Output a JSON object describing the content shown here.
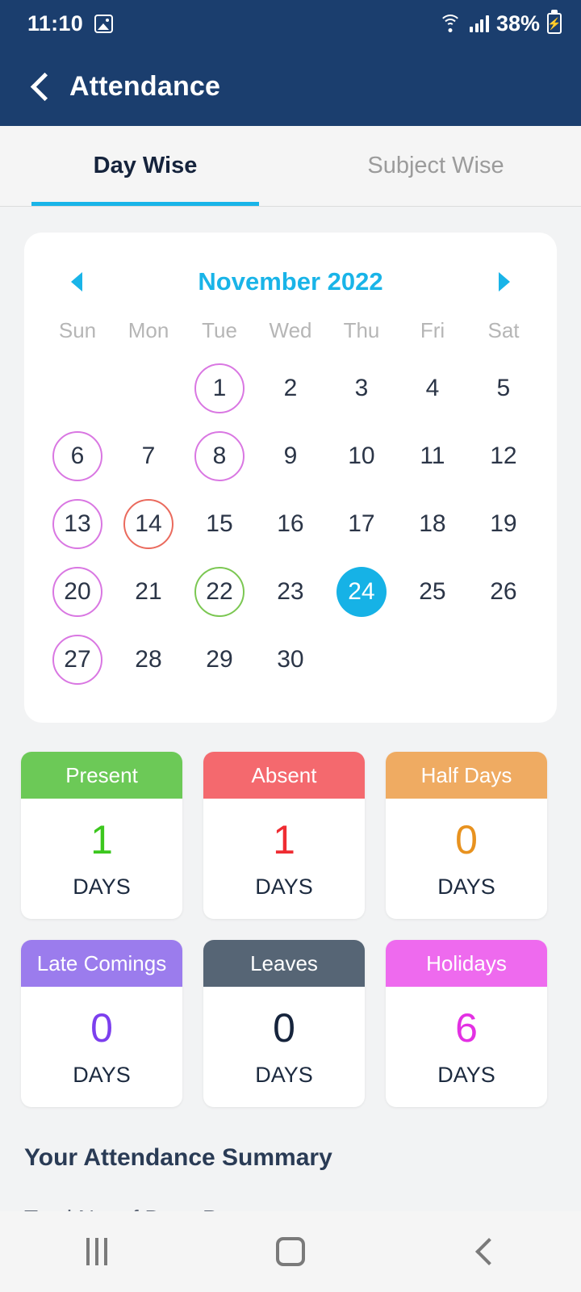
{
  "status_bar": {
    "time": "11:10",
    "image_icon": "image-icon",
    "wifi_icon": "wifi-icon",
    "signal_icon": "signal-bars-icon",
    "battery_percent": "38%",
    "battery_icon": "battery-charging-icon"
  },
  "header": {
    "back_icon": "back-chevron-icon",
    "title": "Attendance",
    "bg_color": "#1b3e6e"
  },
  "tabs": [
    {
      "label": "Day Wise",
      "active": true
    },
    {
      "label": "Subject Wise",
      "active": false
    }
  ],
  "accent_color": "#19b4e8",
  "calendar": {
    "prev_icon": "chevron-left-icon",
    "next_icon": "chevron-right-icon",
    "month_label": "November 2022",
    "weekdays": [
      "Sun",
      "Mon",
      "Tue",
      "Wed",
      "Thu",
      "Fri",
      "Sat"
    ],
    "leading_blanks": 2,
    "days": [
      {
        "day": "1",
        "state": "holiday"
      },
      {
        "day": "2",
        "state": "none"
      },
      {
        "day": "3",
        "state": "none"
      },
      {
        "day": "4",
        "state": "none"
      },
      {
        "day": "5",
        "state": "none"
      },
      {
        "day": "6",
        "state": "holiday"
      },
      {
        "day": "7",
        "state": "none"
      },
      {
        "day": "8",
        "state": "holiday"
      },
      {
        "day": "9",
        "state": "none"
      },
      {
        "day": "10",
        "state": "none"
      },
      {
        "day": "11",
        "state": "none"
      },
      {
        "day": "12",
        "state": "none"
      },
      {
        "day": "13",
        "state": "holiday"
      },
      {
        "day": "14",
        "state": "absent"
      },
      {
        "day": "15",
        "state": "none"
      },
      {
        "day": "16",
        "state": "none"
      },
      {
        "day": "17",
        "state": "none"
      },
      {
        "day": "18",
        "state": "none"
      },
      {
        "day": "19",
        "state": "none"
      },
      {
        "day": "20",
        "state": "holiday"
      },
      {
        "day": "21",
        "state": "none"
      },
      {
        "day": "22",
        "state": "present"
      },
      {
        "day": "23",
        "state": "none"
      },
      {
        "day": "24",
        "state": "today"
      },
      {
        "day": "25",
        "state": "none"
      },
      {
        "day": "26",
        "state": "none"
      },
      {
        "day": "27",
        "state": "holiday"
      },
      {
        "day": "28",
        "state": "none"
      },
      {
        "day": "29",
        "state": "none"
      },
      {
        "day": "30",
        "state": "none"
      }
    ],
    "legend_colors": {
      "holiday": "#d977e2",
      "absent": "#ea6a5d",
      "present": "#7bc752",
      "today": "#16b2e6"
    }
  },
  "stats": [
    {
      "label": "Present",
      "value": "1",
      "unit": "DAYS",
      "header_color": "#6cc957",
      "value_color": "#3cc71e"
    },
    {
      "label": "Absent",
      "value": "1",
      "unit": "DAYS",
      "header_color": "#f4696e",
      "value_color": "#ef2c32"
    },
    {
      "label": "Half Days",
      "value": "0",
      "unit": "DAYS",
      "header_color": "#efab62",
      "value_color": "#e8921f"
    },
    {
      "label": "Late Comings",
      "value": "0",
      "unit": "DAYS",
      "header_color": "#9b7ced",
      "value_color": "#7c3fee"
    },
    {
      "label": "Leaves",
      "value": "0",
      "unit": "DAYS",
      "header_color": "#566575",
      "value_color": "#16243c"
    },
    {
      "label": "Holidays",
      "value": "6",
      "unit": "DAYS",
      "header_color": "#ee6aee",
      "value_color": "#e331e3"
    }
  ],
  "summary": {
    "title": "Your Attendance Summary",
    "first_row": "Total No. of Days Present"
  },
  "nav_bar": {
    "recents_icon": "recents-icon",
    "home_icon": "home-icon",
    "back_icon": "back-icon"
  }
}
